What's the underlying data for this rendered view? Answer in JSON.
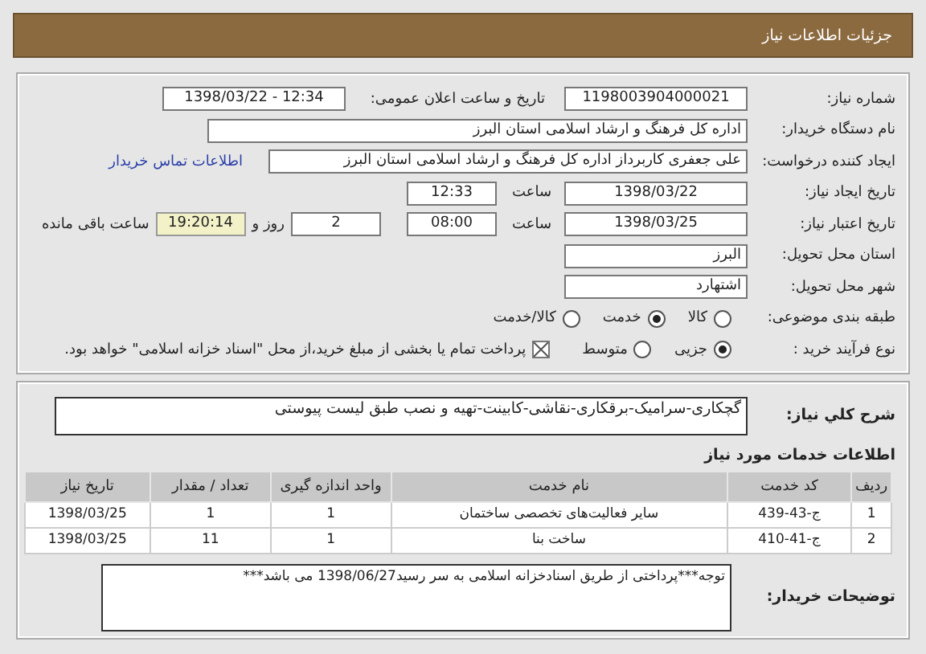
{
  "header": {
    "title": "جزئیات اطلاعات نیاز"
  },
  "need_number": {
    "label": "شماره نیاز:",
    "value": "1198003904000021"
  },
  "announce": {
    "label": "تاریخ و ساعت اعلان عمومی:",
    "value": "1398/03/22 - 12:34"
  },
  "buyer_org": {
    "label": "نام دستگاه خریدار:",
    "value": "اداره کل فرهنگ و ارشاد اسلامی استان البرز"
  },
  "requester": {
    "label": "ایجاد کننده درخواست:",
    "value": "علی جعفری کاربرداز اداره کل فرهنگ و ارشاد اسلامی استان البرز",
    "link": "اطلاعات تماس خریدار"
  },
  "created": {
    "label": "تاریخ ایجاد نیاز:",
    "date": "1398/03/22",
    "time_label": "ساعت",
    "time": "12:33"
  },
  "validity": {
    "label": "تاریخ اعتبار نیاز:",
    "date": "1398/03/25",
    "time_label": "ساعت",
    "time": "08:00",
    "days": "2",
    "days_label": "روز و",
    "remaining": "19:20:14",
    "remaining_label": "ساعت باقی مانده"
  },
  "province": {
    "label": "استان محل تحویل:",
    "value": "البرز"
  },
  "city": {
    "label": "شهر محل تحویل:",
    "value": "اشتهارد"
  },
  "category": {
    "label": "طبقه بندی موضوعی:",
    "options": [
      {
        "label": "کالا",
        "selected": false
      },
      {
        "label": "خدمت",
        "selected": true
      },
      {
        "label": "کالا/خدمت",
        "selected": false
      }
    ]
  },
  "process": {
    "label": "نوع فرآیند خرید :",
    "options": [
      {
        "label": "جزیی",
        "selected": true
      },
      {
        "label": "متوسط",
        "selected": false
      }
    ],
    "payment_note": {
      "label": "پرداخت تمام یا بخشی از مبلغ خرید،از محل \"اسناد خزانه اسلامی\" خواهد بود.",
      "checked": true
    }
  },
  "description": {
    "label": "شرح کلي نیاز:",
    "value": "گچکاری-سرامیک-برقکاری-نقاشی-کابینت-تهیه و نصب طبق لیست پیوستی"
  },
  "services": {
    "title": "اطلاعات خدمات مورد نیاز",
    "columns": [
      "ردیف",
      "کد خدمت",
      "نام خدمت",
      "واحد اندازه گیری",
      "تعداد / مقدار",
      "تاریخ نیاز"
    ],
    "rows": [
      [
        "1",
        "ج-43-439",
        "سایر فعالیت‌های تخصصی ساختمان",
        "1",
        "1",
        "1398/03/25"
      ],
      [
        "2",
        "ج-41-410",
        "ساخت بنا",
        "1",
        "11",
        "1398/03/25"
      ]
    ]
  },
  "buyer_notes": {
    "label": "توضیحات خریدار:",
    "value": "توجه***پرداختی از طریق اسنادخزانه اسلامی به سر رسید1398/06/27 می باشد***"
  }
}
